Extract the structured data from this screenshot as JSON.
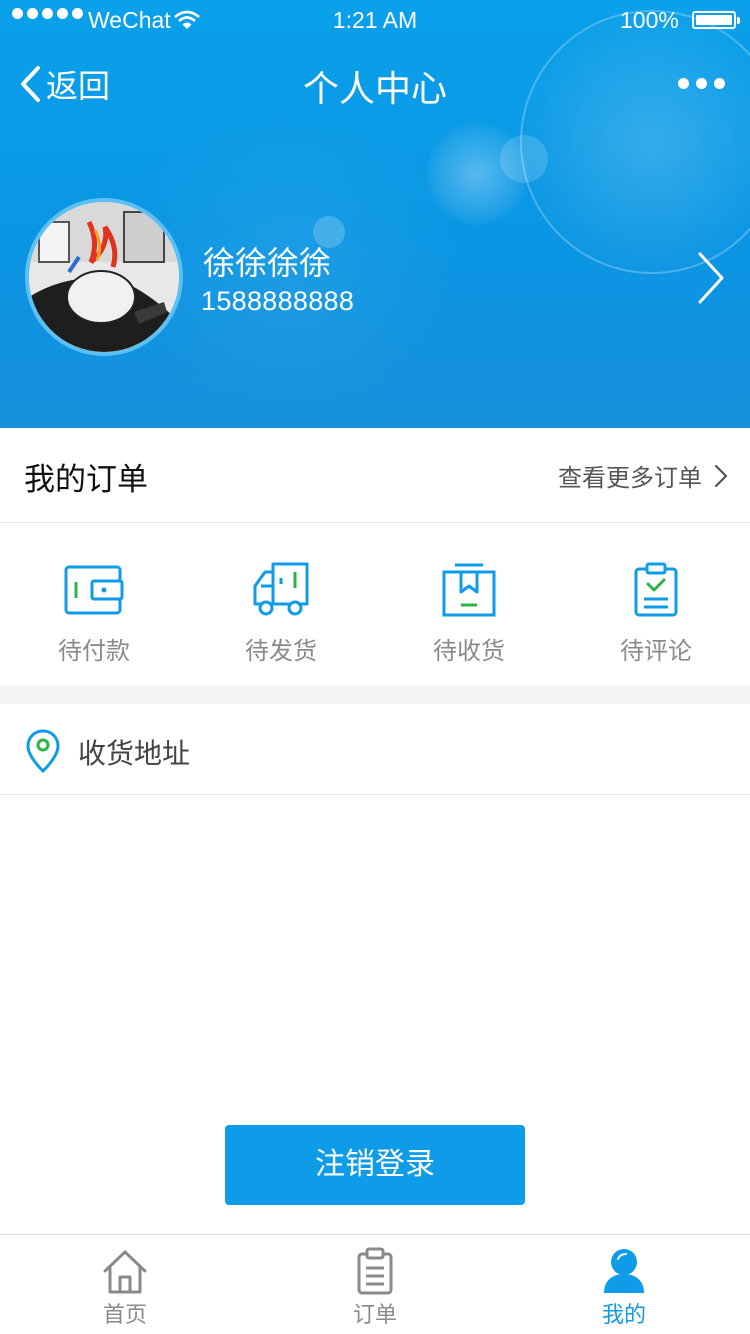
{
  "status_bar": {
    "carrier": "WeChat",
    "time": "1:21 AM",
    "battery": "100%"
  },
  "nav": {
    "back_label": "返回",
    "title": "个人中心"
  },
  "profile": {
    "name": "徐徐徐徐",
    "phone": "1588888888"
  },
  "orders": {
    "title": "我的订单",
    "more_label": "查看更多订单",
    "items": [
      {
        "label": "待付款",
        "icon": "wallet-icon"
      },
      {
        "label": "待发货",
        "icon": "truck-icon"
      },
      {
        "label": "待收货",
        "icon": "package-icon"
      },
      {
        "label": "待评论",
        "icon": "clipboard-check-icon"
      }
    ]
  },
  "address": {
    "label": "收货地址",
    "icon": "location-pin-icon"
  },
  "logout_label": "注销登录",
  "tabbar": {
    "items": [
      {
        "label": "首页",
        "icon": "home-icon"
      },
      {
        "label": "订单",
        "icon": "clipboard-icon"
      },
      {
        "label": "我的",
        "icon": "user-icon",
        "active": true
      }
    ]
  },
  "colors": {
    "brand_blue": "#0e9be8",
    "accent_green": "#2db34a",
    "header_blue": "#0a9be6"
  }
}
